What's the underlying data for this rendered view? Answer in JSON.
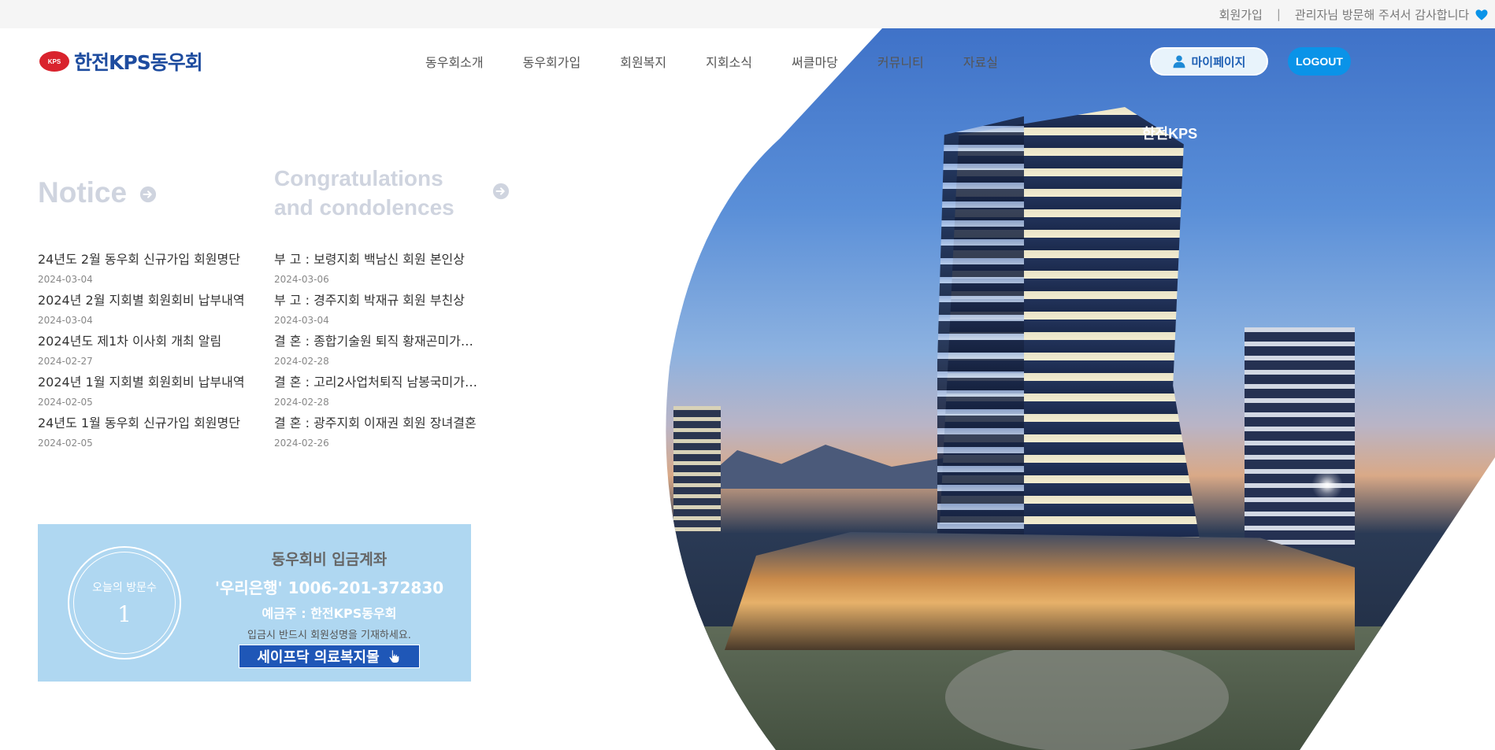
{
  "topbar": {
    "signup": "회원가입",
    "separator": "|",
    "greeting": "관리자님 방문해 주셔서 감사합니다"
  },
  "logo": {
    "mark": "KPS",
    "text": "한전KPS동우회"
  },
  "nav": {
    "items": [
      "동우회소개",
      "동우회가입",
      "회원복지",
      "지회소식",
      "써클마당",
      "커뮤니티",
      "자료실"
    ]
  },
  "buttons": {
    "mypage": "마이페이지",
    "logout": "LOGOUT"
  },
  "hero": {
    "building_sign": "한전KPS"
  },
  "notice": {
    "title": "Notice",
    "posts": [
      {
        "title": "24년도 2월 동우회 신규가입 회원명단",
        "date": "2024-03-04"
      },
      {
        "title": "2024년 2월 지회별 회원회비 납부내역",
        "date": "2024-03-04"
      },
      {
        "title": "2024년도 제1차 이사회 개최 알림",
        "date": "2024-02-27"
      },
      {
        "title": "2024년 1월 지회별 회원회비 납부내역",
        "date": "2024-02-05"
      },
      {
        "title": "24년도 1월 동우회 신규가입 회원명단",
        "date": "2024-02-05"
      }
    ]
  },
  "congratulations": {
    "title": "Congratulations and condolences",
    "posts": [
      {
        "title": "부 고 : 보령지회 백남신 회원 본인상",
        "date": "2024-03-06"
      },
      {
        "title": "부 고 : 경주지회 박재규 회원 부친상",
        "date": "2024-03-04"
      },
      {
        "title": "결 혼 : 종합기술원 퇴직 황재곤미가…",
        "date": "2024-02-28"
      },
      {
        "title": "결 혼 : 고리2사업처퇴직 남봉국미가…",
        "date": "2024-02-28"
      },
      {
        "title": "결 혼 : 광주지회 이재권 회원 장녀결혼",
        "date": "2024-02-26"
      }
    ]
  },
  "visitor": {
    "label": "오늘의 방문수",
    "count": "1"
  },
  "account": {
    "title": "동우회비 입금계좌",
    "number": "'우리은행' 1006-201-372830",
    "holder": "예금주 : 한전KPS동우회",
    "note": "입금시 반드시 회원성명을 기재하세요.",
    "mall_button": "세이프닥 의료복지몰"
  },
  "colors": {
    "accent_blue": "#0a93e8",
    "logo_blue": "#1e4c9f",
    "logo_red": "#d9232d",
    "account_bg": "#afd7f1",
    "mall_button_bg": "#1f57b7",
    "heart": "#0a93e8"
  },
  "icons": [
    "heart-icon",
    "user-icon",
    "arrow-right-circle-icon",
    "hand-pointer-icon"
  ]
}
